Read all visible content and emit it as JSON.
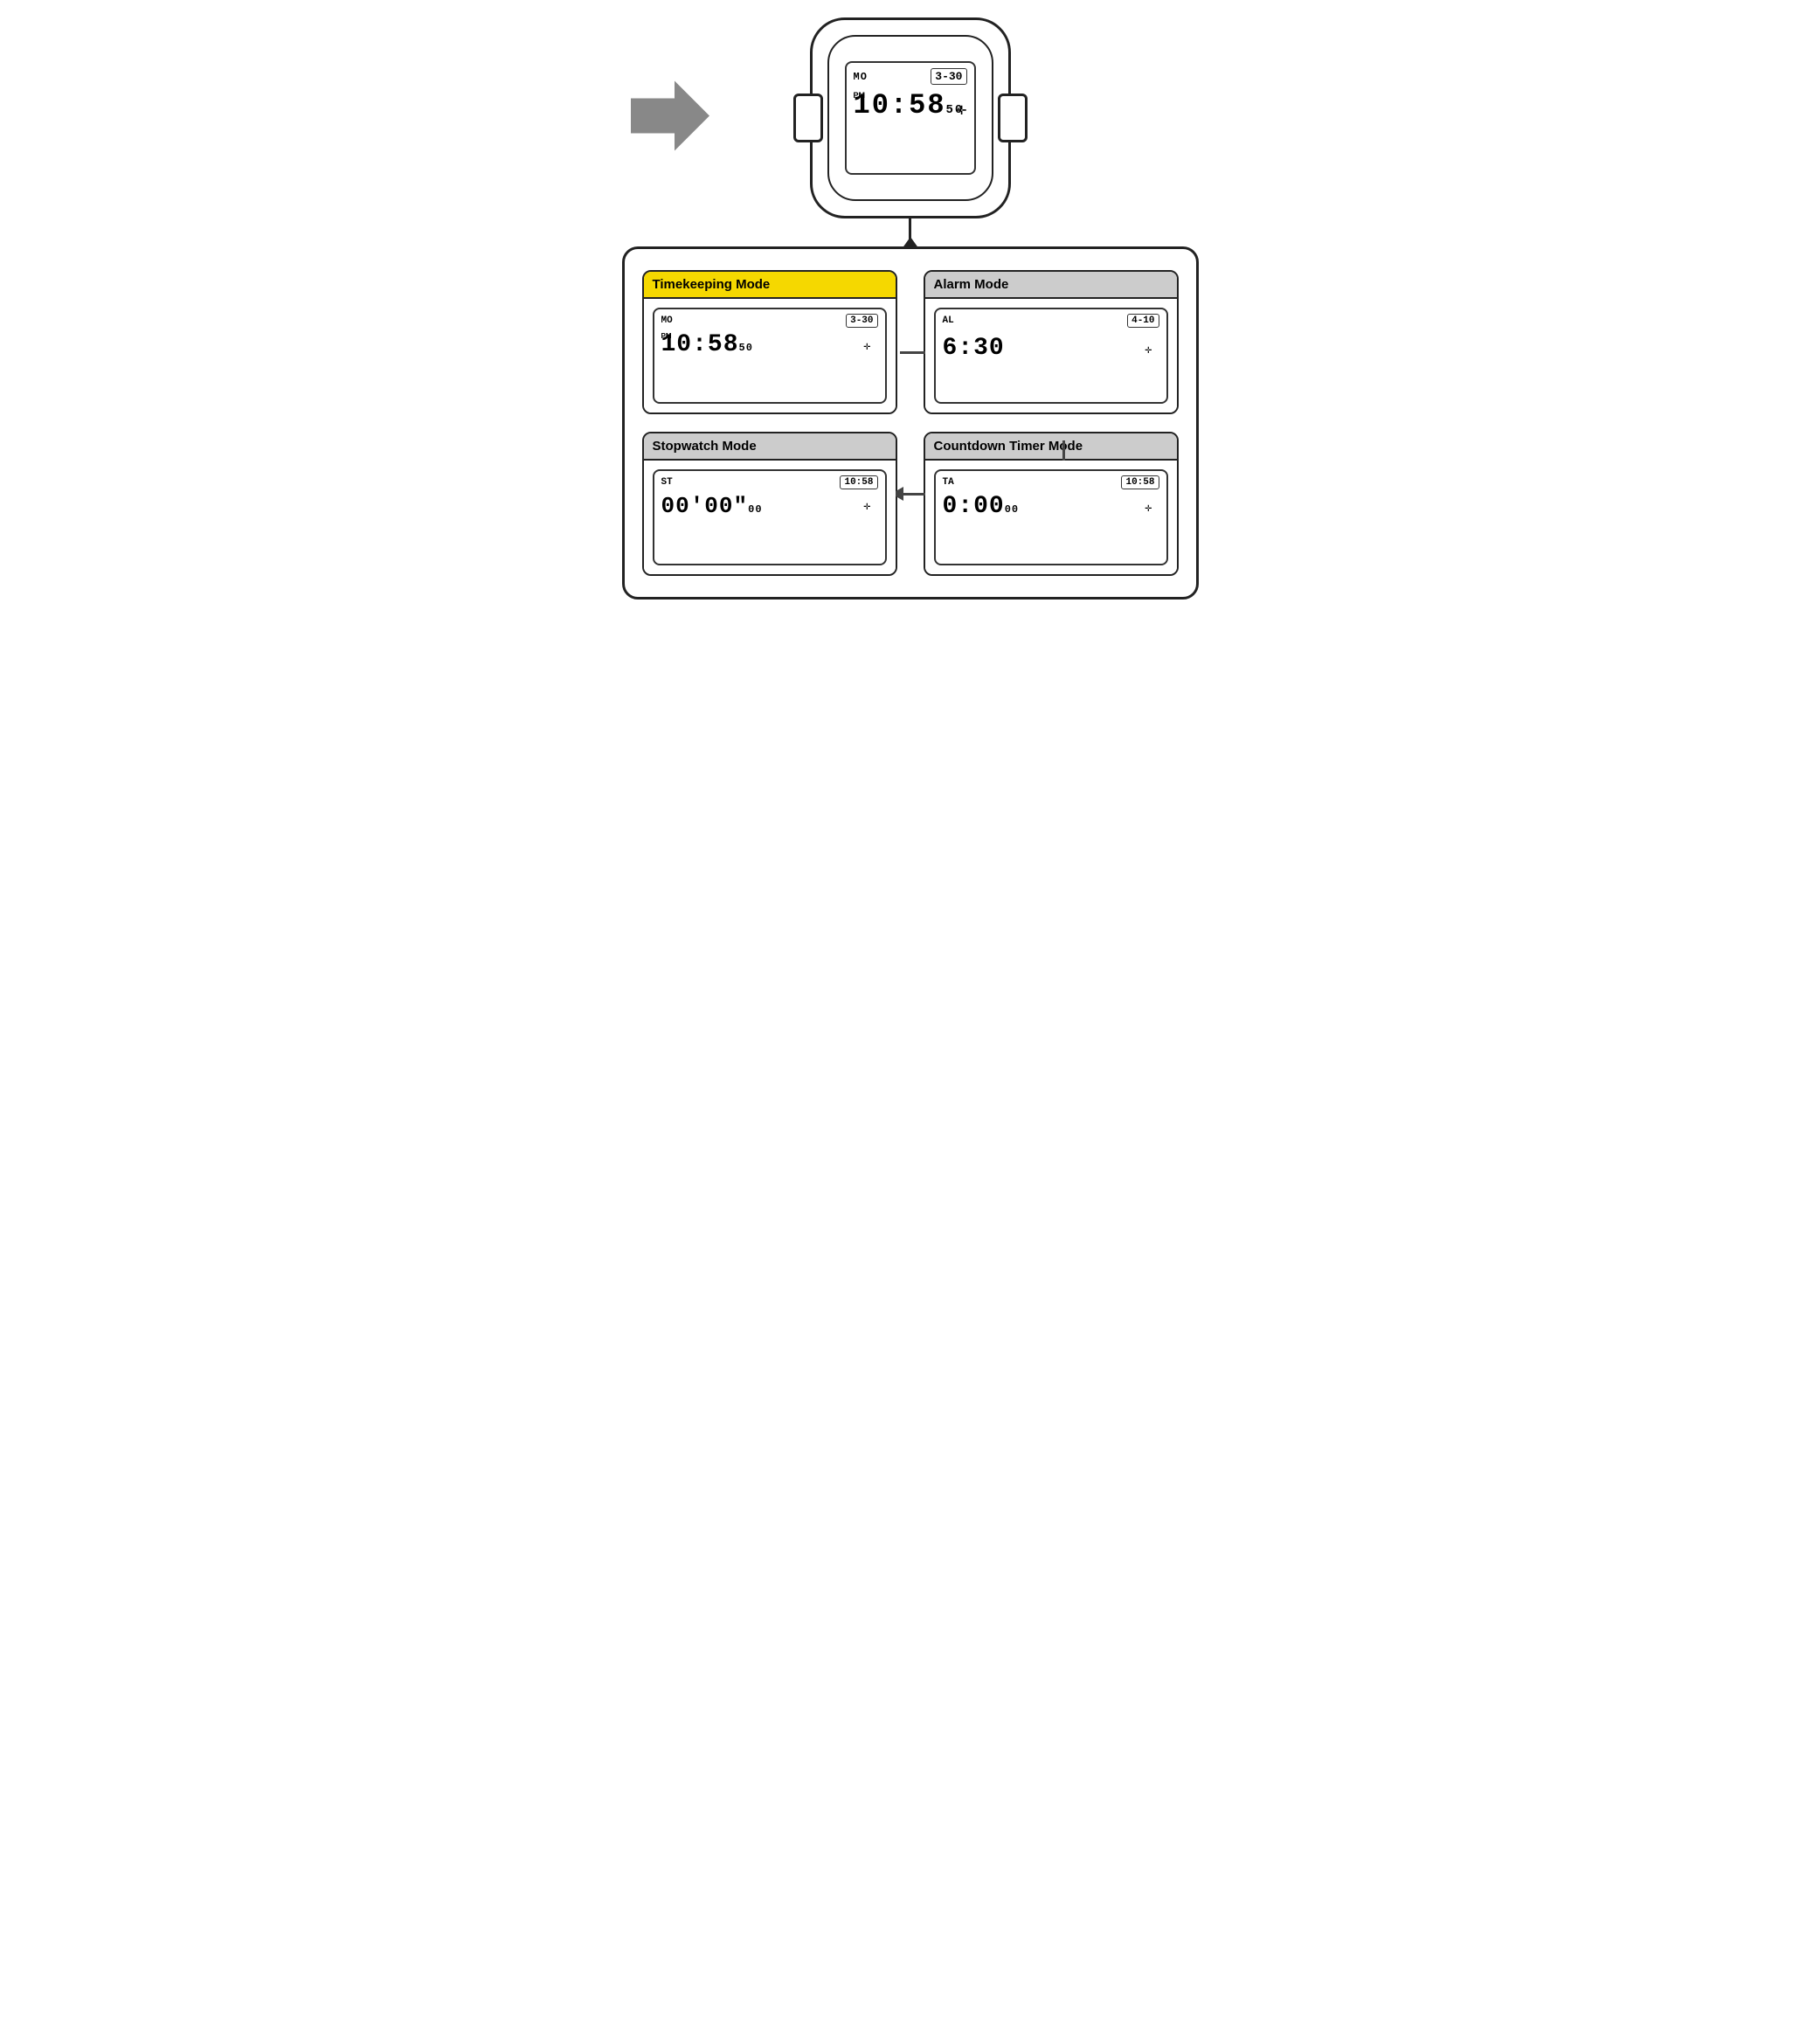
{
  "watch": {
    "mode": "MO",
    "date": "3-30",
    "pm_label": "PM",
    "time_main": "10:58",
    "time_seconds": "50",
    "compass": "✛"
  },
  "diagram": {
    "timekeeping": {
      "title": "Timekeeping Mode",
      "active": true,
      "mode_code": "MO",
      "date": "3-30",
      "pm_label": "PM",
      "time_main": "10:58",
      "time_seconds": "50",
      "compass": "✛"
    },
    "alarm": {
      "title": "Alarm Mode",
      "active": false,
      "mode_code": "AL",
      "date": "4-10",
      "pm_label": "",
      "time_main": "6:30",
      "time_seconds": "",
      "compass": "✛"
    },
    "stopwatch": {
      "title": "Stopwatch Mode",
      "active": false,
      "mode_code": "ST",
      "date": "10:58",
      "pm_label": "",
      "time_main": "00'00\"",
      "time_seconds": "00",
      "compass": "✛"
    },
    "countdown": {
      "title": "Countdown Timer Mode",
      "active": false,
      "mode_code": "TA",
      "date": "10:58",
      "pm_label": "",
      "time_main": "0:00",
      "time_seconds": "00",
      "compass": "✛"
    }
  }
}
